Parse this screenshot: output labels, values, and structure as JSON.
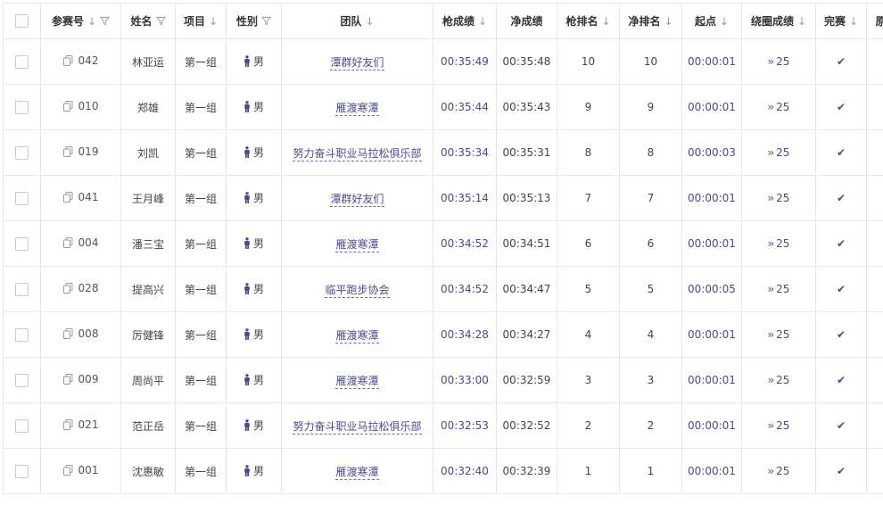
{
  "headers": {
    "bib": "参赛号",
    "name": "姓名",
    "event": "项目",
    "gender": "性别",
    "team": "团队",
    "gun_time": "枪成绩",
    "net_time": "净成绩",
    "gun_rank": "枪排名",
    "net_rank": "净排名",
    "start": "起点",
    "lap": "绕圈成绩",
    "finished": "完赛",
    "extra": "原"
  },
  "rows": [
    {
      "bib": "042",
      "name": "林亚运",
      "event": "第一组",
      "gender": "男",
      "team": "潭群好友们",
      "gun": "00:35:49",
      "net": "00:35:48",
      "gun_rank": "10",
      "net_rank": "10",
      "start": "00:00:01",
      "lap": "25"
    },
    {
      "bib": "010",
      "name": "郑雄",
      "event": "第一组",
      "gender": "男",
      "team": "雁渡寒潭",
      "gun": "00:35:44",
      "net": "00:35:43",
      "gun_rank": "9",
      "net_rank": "9",
      "start": "00:00:01",
      "lap": "25"
    },
    {
      "bib": "019",
      "name": "刘凯",
      "event": "第一组",
      "gender": "男",
      "team": "努力奋斗职业马拉松俱乐部",
      "gun": "00:35:34",
      "net": "00:35:31",
      "gun_rank": "8",
      "net_rank": "8",
      "start": "00:00:03",
      "lap": "25"
    },
    {
      "bib": "041",
      "name": "王月峰",
      "event": "第一组",
      "gender": "男",
      "team": "潭群好友们",
      "gun": "00:35:14",
      "net": "00:35:13",
      "gun_rank": "7",
      "net_rank": "7",
      "start": "00:00:01",
      "lap": "25"
    },
    {
      "bib": "004",
      "name": "潘三宝",
      "event": "第一组",
      "gender": "男",
      "team": "雁渡寒潭",
      "gun": "00:34:52",
      "net": "00:34:51",
      "gun_rank": "6",
      "net_rank": "6",
      "start": "00:00:01",
      "lap": "25"
    },
    {
      "bib": "028",
      "name": "提高兴",
      "event": "第一组",
      "gender": "男",
      "team": "临平跑步协会",
      "gun": "00:34:52",
      "net": "00:34:47",
      "gun_rank": "5",
      "net_rank": "5",
      "start": "00:00:05",
      "lap": "25"
    },
    {
      "bib": "008",
      "name": "厉健锋",
      "event": "第一组",
      "gender": "男",
      "team": "雁渡寒潭",
      "gun": "00:34:28",
      "net": "00:34:27",
      "gun_rank": "4",
      "net_rank": "4",
      "start": "00:00:01",
      "lap": "25"
    },
    {
      "bib": "009",
      "name": "周尚平",
      "event": "第一组",
      "gender": "男",
      "team": "雁渡寒潭",
      "gun": "00:33:00",
      "net": "00:32:59",
      "gun_rank": "3",
      "net_rank": "3",
      "start": "00:00:01",
      "lap": "25"
    },
    {
      "bib": "021",
      "name": "范正岳",
      "event": "第一组",
      "gender": "男",
      "team": "努力奋斗职业马拉松俱乐部",
      "gun": "00:32:53",
      "net": "00:32:52",
      "gun_rank": "2",
      "net_rank": "2",
      "start": "00:00:01",
      "lap": "25"
    },
    {
      "bib": "001",
      "name": "沈惠敏",
      "event": "第一组",
      "gender": "男",
      "team": "雁渡寒潭",
      "gun": "00:32:40",
      "net": "00:32:39",
      "gun_rank": "1",
      "net_rank": "1",
      "start": "00:00:01",
      "lap": "25"
    }
  ],
  "icons": {
    "sort": "arrow-down-icon",
    "filter": "funnel-icon",
    "copy": "copy-icon",
    "male": "person-icon",
    "lap": "double-chevron-right-icon",
    "finished": "checkmark-icon"
  },
  "colors": {
    "accent": "#4a4a8e",
    "border": "#e8e8e8"
  }
}
